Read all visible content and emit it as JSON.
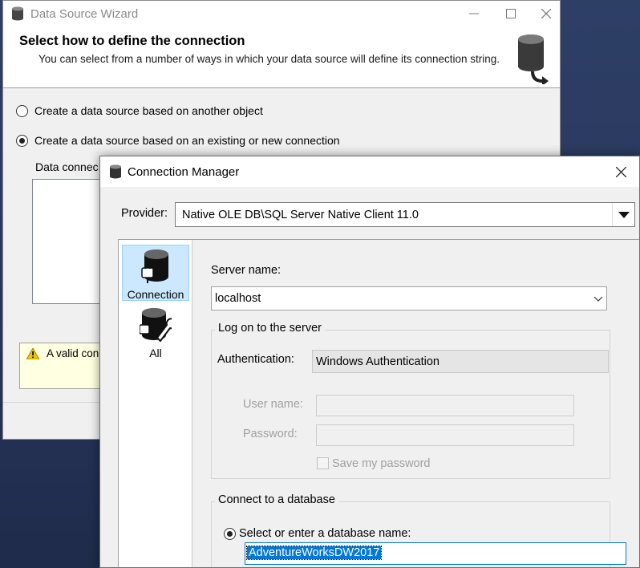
{
  "wizard": {
    "title": "Data Source Wizard",
    "header_title": "Select how to define the connection",
    "header_subtitle": "You can select from a number of ways in which your data source will define its connection string.",
    "radio_options": [
      {
        "label": "Create a data source based on another object",
        "selected": false
      },
      {
        "label": "Create a data source based on an existing or new connection",
        "selected": true
      }
    ],
    "data_connections_label": "Data connec",
    "warning_text": "A valid con"
  },
  "connection_manager": {
    "title": "Connection Manager",
    "provider_label": "Provider:",
    "provider_value": "Native OLE DB\\SQL Server Native Client 11.0",
    "nav": [
      {
        "label": "Connection",
        "icon": "database-plug-icon",
        "selected": true
      },
      {
        "label": "All",
        "icon": "database-wrench-icon",
        "selected": false
      }
    ],
    "server_name_label": "Server name:",
    "server_name_value": "localhost",
    "logon_group_caption": "Log on to the server",
    "authentication_label": "Authentication:",
    "authentication_value": "Windows Authentication",
    "user_name_label": "User name:",
    "password_label": "Password:",
    "save_password_label": "Save my password",
    "connect_db_caption": "Connect to a database",
    "select_db_label": "Select or enter a database name:",
    "database_value": "AdventureWorksDW2017"
  },
  "colors": {
    "selection_blue": "#0078d7",
    "nav_selected": "#cce8ff",
    "warning_bg": "#ffffe1"
  }
}
